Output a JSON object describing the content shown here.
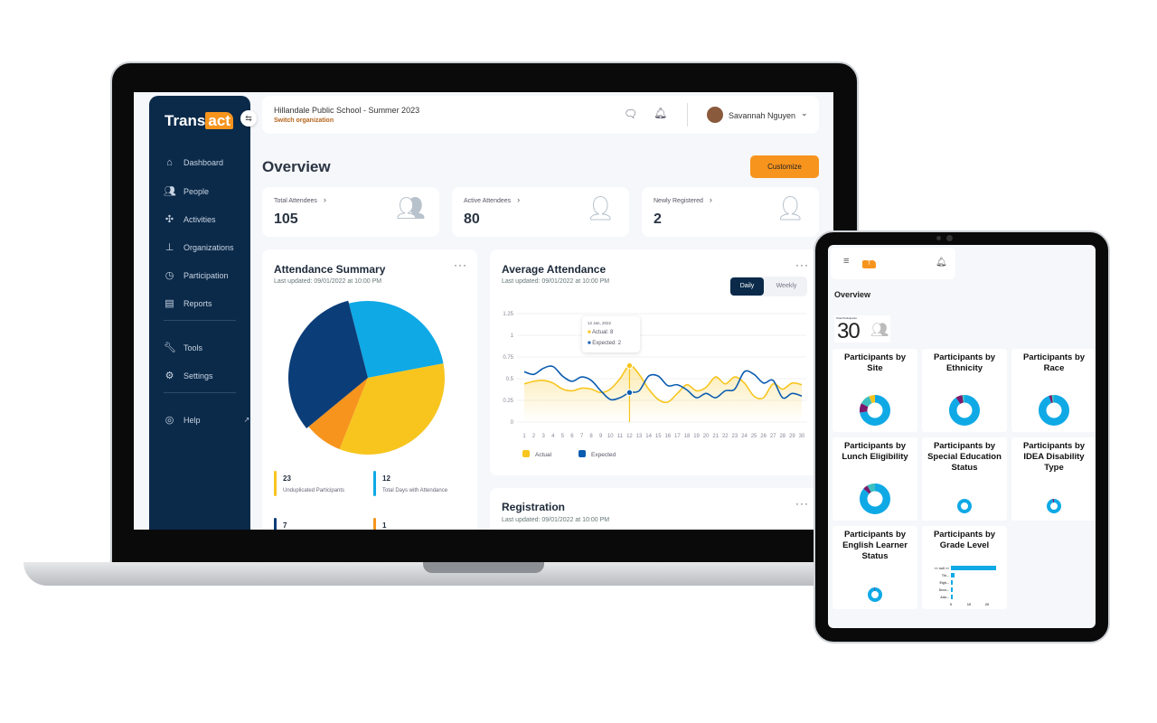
{
  "app": {
    "logo_prefix": "Trans",
    "logo_suffix": "act"
  },
  "header": {
    "org": "Hillandale Public School - Summer 2023",
    "switch": "Switch organization",
    "user": "Savannah Nguyen"
  },
  "sidebar": {
    "items": [
      {
        "label": "Dashboard",
        "icon": "home-icon"
      },
      {
        "label": "People",
        "icon": "people-icon"
      },
      {
        "label": "Activities",
        "icon": "puzzle-icon"
      },
      {
        "label": "Organizations",
        "icon": "org-chart-icon"
      },
      {
        "label": "Participation",
        "icon": "timer-icon"
      },
      {
        "label": "Reports",
        "icon": "clipboard-icon"
      },
      {
        "label": "Tools",
        "icon": "wrench-icon"
      },
      {
        "label": "Settings",
        "icon": "gear-icon"
      },
      {
        "label": "Help",
        "icon": "help-icon"
      }
    ]
  },
  "main": {
    "title": "Overview",
    "customize": "Customize",
    "stats": [
      {
        "label": "Total Attendees",
        "value": "105"
      },
      {
        "label": "Active Attendees",
        "value": "80"
      },
      {
        "label": "Newly Registered",
        "value": "2"
      }
    ],
    "attendance_summary": {
      "title": "Attendance Summary",
      "updated": "Last updated: 09/01/2022 at 10:00 PM",
      "metrics": [
        {
          "value": "23",
          "label": "Unduplicated Participants",
          "color": "#f7c51e"
        },
        {
          "value": "12",
          "label": "Total Days with Attendance",
          "color": "#0fa9e6"
        },
        {
          "value": "7",
          "label": "",
          "color": "#0b3d78"
        },
        {
          "value": "1",
          "label": "",
          "color": "#f7941d"
        }
      ]
    },
    "average_attendance": {
      "title": "Average Attendance",
      "updated": "Last updated: 09/01/2022 at 10:00 PM",
      "tabs": [
        "Daily",
        "Weekly"
      ],
      "active_tab": "Daily",
      "tooltip": {
        "date": "12 Jan, 2022",
        "actual": "Actual: 8",
        "expected": "Expected: 2"
      }
    },
    "registration": {
      "title": "Registration",
      "updated": "Last updated: 09/01/2022 at 10:00 PM"
    }
  },
  "colors": {
    "navy": "#0b2a4a",
    "accent": "#f7941d",
    "actual": "#f7c51e",
    "expected": "#0b5cb0",
    "lightblue": "#0fa9e6"
  },
  "chart_data": [
    {
      "type": "pie",
      "title": "Attendance Summary",
      "slices": [
        {
          "color": "#0fa9e6",
          "value": 26
        },
        {
          "color": "#f7c51e",
          "value": 34
        },
        {
          "color": "#f7941d",
          "value": 8
        },
        {
          "color": "#0b3d78",
          "value": 32
        }
      ]
    },
    {
      "type": "line",
      "title": "Average Attendance",
      "ylim": [
        0,
        1.25
      ],
      "yticks": [
        "0",
        "0.25",
        "0.5",
        "0.75",
        "1",
        "1.25"
      ],
      "x": [
        1,
        2,
        3,
        4,
        5,
        6,
        7,
        8,
        9,
        10,
        11,
        12,
        13,
        14,
        15,
        16,
        17,
        18,
        19,
        20,
        21,
        22,
        23,
        24,
        25,
        26,
        27,
        28,
        29,
        30
      ],
      "series": [
        {
          "name": "Actual",
          "color": "#f7c51e",
          "values": [
            0.44,
            0.47,
            0.48,
            0.45,
            0.38,
            0.36,
            0.39,
            0.38,
            0.34,
            0.38,
            0.5,
            0.65,
            0.55,
            0.38,
            0.26,
            0.23,
            0.33,
            0.43,
            0.36,
            0.4,
            0.52,
            0.44,
            0.52,
            0.45,
            0.3,
            0.28,
            0.44,
            0.38,
            0.45,
            0.43
          ]
        },
        {
          "name": "Expected",
          "color": "#0b5cb0",
          "values": [
            0.58,
            0.55,
            0.62,
            0.64,
            0.53,
            0.47,
            0.52,
            0.48,
            0.36,
            0.26,
            0.28,
            0.34,
            0.36,
            0.53,
            0.53,
            0.42,
            0.43,
            0.37,
            0.28,
            0.33,
            0.28,
            0.36,
            0.38,
            0.58,
            0.55,
            0.45,
            0.48,
            0.28,
            0.33,
            0.3
          ]
        }
      ],
      "legend": "bottom-left"
    }
  ],
  "tablet": {
    "title": "Overview",
    "total_label": "Total Participants",
    "total": "30",
    "tiles": [
      "Participants by Site",
      "Participants by Ethnicity",
      "Participants by Race",
      "Participants by Lunch Eligibility",
      "Participants by Special Education Status",
      "Participants by IDEA Disability Type",
      "Participants by English Learner Status",
      "Participants by Grade Level"
    ],
    "grade_chart": {
      "categories": [
        "<< null >>",
        "Thi...",
        "Eigh...",
        "Seco...",
        "Adu..."
      ],
      "values": [
        25,
        2,
        1,
        1,
        1
      ],
      "xticks": [
        "0",
        "10",
        "20"
      ]
    }
  }
}
